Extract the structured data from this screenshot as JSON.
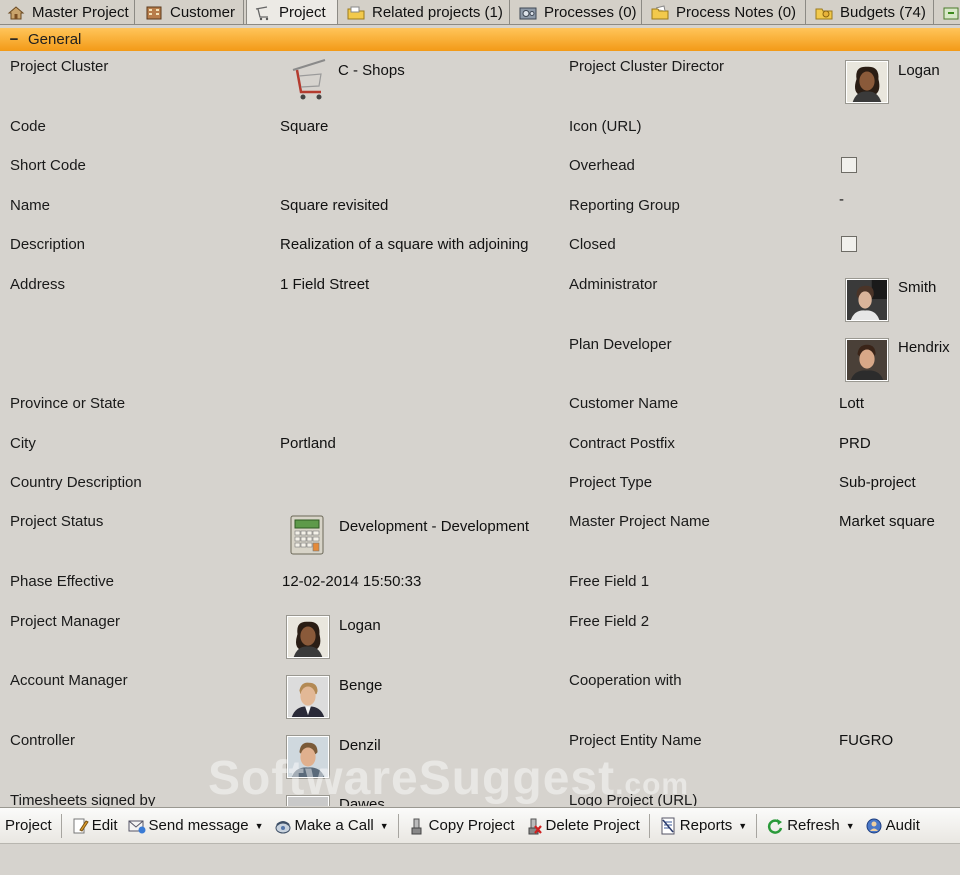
{
  "tabs": [
    {
      "label": "Master Project",
      "icon": "house-icon"
    },
    {
      "label": "Customer",
      "icon": "building-icon"
    },
    {
      "label": "Project",
      "icon": "cart-icon"
    },
    {
      "label": "Related projects (1)",
      "icon": "folder-icon"
    },
    {
      "label": "Processes (0)",
      "icon": "gears-icon"
    },
    {
      "label": "Process Notes (0)",
      "icon": "notes-icon"
    },
    {
      "label": "Budgets (74)",
      "icon": "budget-icon"
    }
  ],
  "section": {
    "collapse": "−",
    "title": "General"
  },
  "left_fields": {
    "project_cluster": {
      "label": "Project Cluster",
      "value": "C - Shops"
    },
    "code": {
      "label": "Code",
      "value": "Square"
    },
    "short_code": {
      "label": "Short Code",
      "value": ""
    },
    "name": {
      "label": "Name",
      "value": "Square revisited"
    },
    "description": {
      "label": "Description",
      "value": "Realization of a square with adjoining"
    },
    "address": {
      "label": "Address",
      "value": "1 Field Street"
    },
    "province": {
      "label": "Province or State",
      "value": ""
    },
    "city": {
      "label": "City",
      "value": "Portland"
    },
    "country": {
      "label": "Country Description",
      "value": ""
    },
    "project_status": {
      "label": "Project Status",
      "value": "Development - Development"
    },
    "phase_effective": {
      "label": "Phase Effective",
      "value": "12-02-2014 15:50:33"
    },
    "project_manager": {
      "label": "Project Manager",
      "value": "Logan"
    },
    "account_manager": {
      "label": "Account Manager",
      "value": "Benge"
    },
    "controller": {
      "label": "Controller",
      "value": "Denzil"
    },
    "timesheets": {
      "label": "Timesheets signed by",
      "value": "Dawes"
    }
  },
  "right_fields": {
    "cluster_director": {
      "label": "Project Cluster Director",
      "value": "Logan"
    },
    "icon_url": {
      "label": "Icon (URL)",
      "value": ""
    },
    "overhead": {
      "label": "Overhead",
      "checked": false
    },
    "reporting_group": {
      "label": "Reporting Group",
      "value": "-"
    },
    "closed": {
      "label": "Closed",
      "checked": false
    },
    "administrator": {
      "label": "Administrator",
      "value": "Smith"
    },
    "plan_developer": {
      "label": "Plan Developer",
      "value": "Hendrix"
    },
    "customer_name": {
      "label": "Customer Name",
      "value": "Lott"
    },
    "contract_postfix": {
      "label": "Contract Postfix",
      "value": "PRD"
    },
    "project_type": {
      "label": "Project Type",
      "value": "Sub-project"
    },
    "master_project_name": {
      "label": "Master Project Name",
      "value": "Market square"
    },
    "free_field_1": {
      "label": "Free Field 1",
      "value": ""
    },
    "free_field_2": {
      "label": "Free Field 2",
      "value": ""
    },
    "cooperation": {
      "label": "Cooperation with",
      "value": ""
    },
    "entity_name": {
      "label": "Project Entity Name",
      "value": "FUGRO"
    },
    "logo_url": {
      "label": "Logo Project (URL)",
      "value": ""
    }
  },
  "watermark": {
    "main": "SoftwareSuggest",
    "suffix": ".com"
  },
  "toolbar": {
    "project": "Project",
    "edit": "Edit",
    "send_message": "Send message",
    "make_call": "Make a Call",
    "copy_project": "Copy Project",
    "delete_project": "Delete Project",
    "reports": "Reports",
    "refresh": "Refresh",
    "audit": "Audit"
  },
  "colors": {
    "section_header": "#f5a623",
    "background": "#d6d3ce"
  }
}
